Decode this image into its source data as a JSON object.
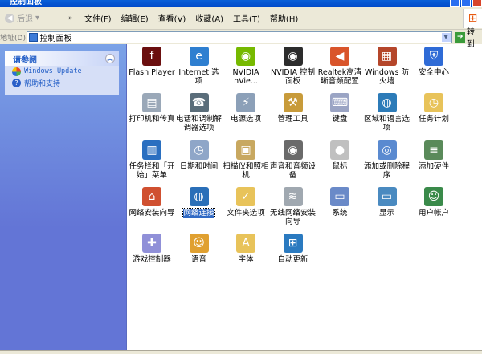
{
  "window": {
    "title": "控制面板"
  },
  "toolbar": {
    "back_label": "后退",
    "more": "»",
    "menu": [
      "文件(F)",
      "编辑(E)",
      "查看(V)",
      "收藏(A)",
      "工具(T)",
      "帮助(H)"
    ]
  },
  "address": {
    "label": "地址(D)",
    "value": "控制面板",
    "go_label": "转到"
  },
  "sidebar": {
    "title": "请参阅",
    "links": [
      {
        "label": "Windows Update",
        "icon": "windows-update-icon"
      },
      {
        "label": "帮助和支持",
        "icon": "help-icon"
      }
    ]
  },
  "items": [
    {
      "label": "Flash Player",
      "color": "#6b0f0f",
      "glyph": "f"
    },
    {
      "label": "Internet 选项",
      "color": "#2f7fd0",
      "glyph": "e"
    },
    {
      "label": "NVIDIA nVie...",
      "color": "#76b900",
      "glyph": "◉"
    },
    {
      "label": "NVIDIA 控制面板",
      "color": "#2c2c2c",
      "glyph": "◉"
    },
    {
      "label": "Realtek高清晰音频配置",
      "color": "#d9552b",
      "glyph": "◀"
    },
    {
      "label": "Windows 防火墙",
      "color": "#b5462a",
      "glyph": "▦"
    },
    {
      "label": "安全中心",
      "color": "#2f6bd6",
      "glyph": "⛨"
    },
    {
      "label": "打印机和传真",
      "color": "#9aa8b8",
      "glyph": "▤"
    },
    {
      "label": "电话和调制解调器选项",
      "color": "#5a6d7a",
      "glyph": "☎"
    },
    {
      "label": "电源选项",
      "color": "#8ca0b8",
      "glyph": "⚡"
    },
    {
      "label": "管理工具",
      "color": "#c89b3a",
      "glyph": "⚒"
    },
    {
      "label": "键盘",
      "color": "#9aa4c4",
      "glyph": "⌨"
    },
    {
      "label": "区域和语言选项",
      "color": "#2c7bb8",
      "glyph": "◍"
    },
    {
      "label": "任务计划",
      "color": "#e8c35a",
      "glyph": "◷"
    },
    {
      "label": "任务栏和「开始」菜单",
      "color": "#2a6fc0",
      "glyph": "▥"
    },
    {
      "label": "日期和时间",
      "color": "#8fa6c8",
      "glyph": "◷"
    },
    {
      "label": "扫描仪和照相机",
      "color": "#c8a860",
      "glyph": "▣"
    },
    {
      "label": "声音和音频设备",
      "color": "#6a6a6a",
      "glyph": "◉"
    },
    {
      "label": "鼠标",
      "color": "#c0c0c0",
      "glyph": "●"
    },
    {
      "label": "添加或删除程序",
      "color": "#5a8ad0",
      "glyph": "◎"
    },
    {
      "label": "添加硬件",
      "color": "#5a8a5a",
      "glyph": "≡"
    },
    {
      "label": "网络安装向导",
      "color": "#d05030",
      "glyph": "⌂"
    },
    {
      "label": "网络连接",
      "color": "#2a6fb8",
      "glyph": "◍",
      "selected": true
    },
    {
      "label": "文件夹选项",
      "color": "#e8c35a",
      "glyph": "✓"
    },
    {
      "label": "无线网络安装向导",
      "color": "#a0a8b0",
      "glyph": "≋"
    },
    {
      "label": "系统",
      "color": "#6a8ac8",
      "glyph": "▭"
    },
    {
      "label": "显示",
      "color": "#4a8ac0",
      "glyph": "▭"
    },
    {
      "label": "用户帐户",
      "color": "#3a8a4a",
      "glyph": "☺"
    },
    {
      "label": "游戏控制器",
      "color": "#9090d8",
      "glyph": "✚"
    },
    {
      "label": "语音",
      "color": "#e0a030",
      "glyph": "☺"
    },
    {
      "label": "字体",
      "color": "#e8c35a",
      "glyph": "A"
    },
    {
      "label": "自动更新",
      "color": "#2a7ac0",
      "glyph": "⊞"
    }
  ]
}
